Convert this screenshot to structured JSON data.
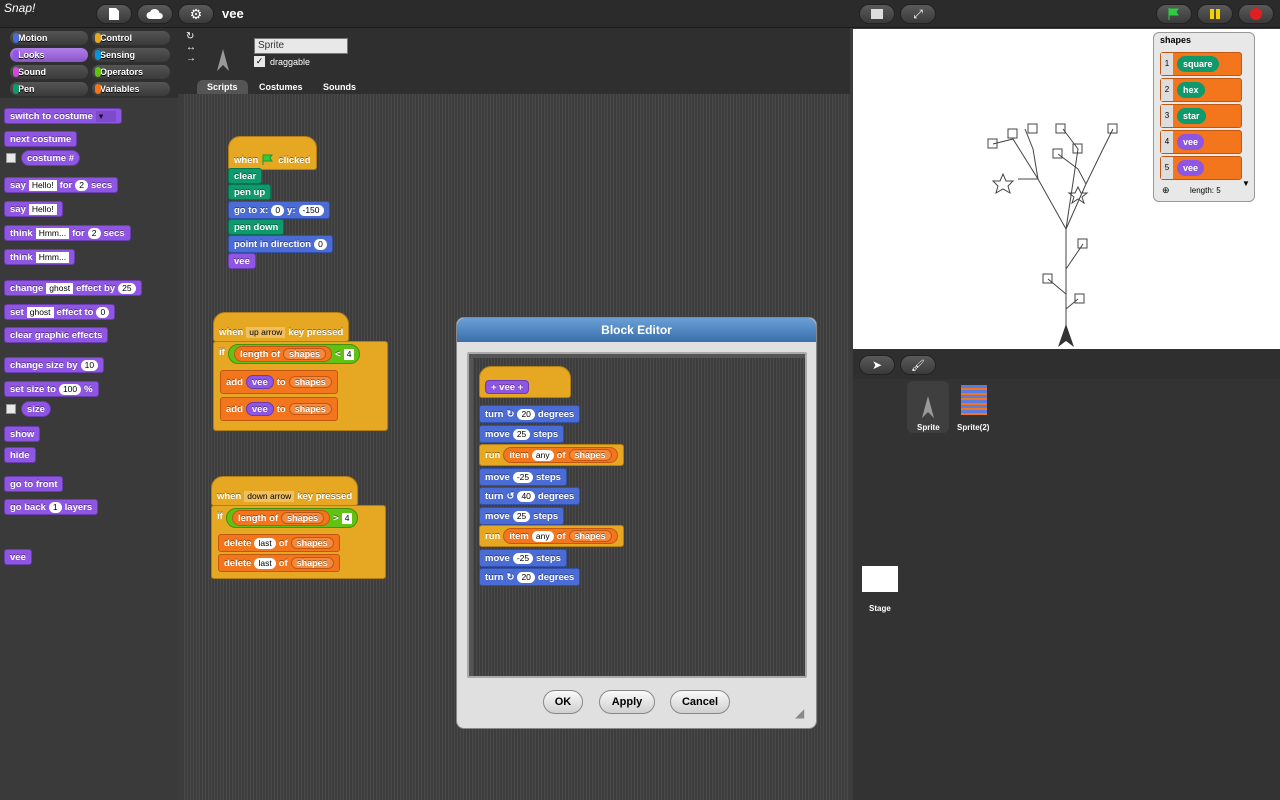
{
  "app": {
    "logo_text": "Snap!",
    "project_title": "vee"
  },
  "toolbar": {
    "icons": [
      "file-icon",
      "cloud-icon",
      "gear-icon"
    ],
    "stage_size_icons": [
      "normal-stage-icon",
      "fullscreen-icon"
    ],
    "run_icons": [
      "green-flag-icon",
      "pause-icon",
      "stop-icon"
    ]
  },
  "categories": [
    {
      "label": "Motion",
      "color": "#4a6cd4"
    },
    {
      "label": "Control",
      "color": "#e6a822"
    },
    {
      "label": "Looks",
      "color": "#8f56e3"
    },
    {
      "label": "Sensing",
      "color": "#0494dc"
    },
    {
      "label": "Sound",
      "color": "#cf4ad9"
    },
    {
      "label": "Operators",
      "color": "#62c213"
    },
    {
      "label": "Pen",
      "color": "#0e9a6c"
    },
    {
      "label": "Variables",
      "color": "#f3761d"
    }
  ],
  "palette": {
    "switch_costume": "switch to costume",
    "next_costume": "next costume",
    "costume_num": "costume #",
    "say": "say",
    "say_text": "Hello!",
    "for": "for",
    "say_secs": "2",
    "secs": "secs",
    "say2": "say",
    "say2_text": "Hello!",
    "think": "think",
    "think_text": "Hmm...",
    "think_secs": "2",
    "think2": "think",
    "think2_text": "Hmm...",
    "change": "change",
    "ghost": "ghost",
    "effect_by": "effect by",
    "change_val": "25",
    "set": "set",
    "effect_to": "effect to",
    "set_val": "0",
    "clear_effects": "clear graphic effects",
    "change_size": "change size by",
    "change_size_val": "10",
    "set_size": "set size to",
    "set_size_val": "100",
    "percent": "%",
    "size": "size",
    "show": "show",
    "hide": "hide",
    "go_front": "go to front",
    "go_back": "go back",
    "go_back_val": "1",
    "layers": "layers",
    "vee": "vee"
  },
  "sprite": {
    "name": "Sprite",
    "draggable_label": "draggable",
    "draggable_check": "✓"
  },
  "tabs": [
    "Scripts",
    "Costumes",
    "Sounds"
  ],
  "script1": {
    "when": "when",
    "clicked": "clicked",
    "clear": "clear",
    "pen_up": "pen up",
    "go_to_x": "go to x:",
    "x": "0",
    "y_label": "y:",
    "y": "-150",
    "pen_down": "pen down",
    "point": "point in direction",
    "dir": "0",
    "vee": "vee"
  },
  "script2": {
    "when": "when",
    "key": "up arrow",
    "key_pressed": "key pressed",
    "if": "if",
    "length_of": "length of",
    "shapes": "shapes",
    "op": "<",
    "num": "4",
    "add": "add",
    "vee": "vee",
    "to": "to"
  },
  "script3": {
    "when": "when",
    "key": "down arrow",
    "key_pressed": "key pressed",
    "if": "if",
    "length_of": "length of",
    "shapes": "shapes",
    "op": ">",
    "num": "4",
    "delete": "delete",
    "last": "last",
    "of": "of"
  },
  "editor": {
    "title": "Block Editor",
    "hat": "+ vee +",
    "turn": "turn",
    "degrees": "degrees",
    "t1": "20",
    "move": "move",
    "steps": "steps",
    "m1": "25",
    "run": "run",
    "item": "item",
    "any": "any",
    "of": "of",
    "shapes": "shapes",
    "m2": "-25",
    "t2": "40",
    "m3": "25",
    "m4": "-25",
    "t3": "20",
    "ok": "OK",
    "apply": "Apply",
    "cancel": "Cancel"
  },
  "watcher": {
    "title": "shapes",
    "items": [
      {
        "idx": "1",
        "label": "square",
        "color": "#0e9a6c"
      },
      {
        "idx": "2",
        "label": "hex",
        "color": "#0e9a6c"
      },
      {
        "idx": "3",
        "label": "star",
        "color": "#0e9a6c"
      },
      {
        "idx": "4",
        "label": "vee",
        "color": "#8f56e3"
      },
      {
        "idx": "5",
        "label": "vee",
        "color": "#8f56e3"
      }
    ],
    "length_label": "length: 5"
  },
  "corral": {
    "sprites": [
      "Sprite",
      "Sprite(2)"
    ],
    "stage_label": "Stage"
  }
}
